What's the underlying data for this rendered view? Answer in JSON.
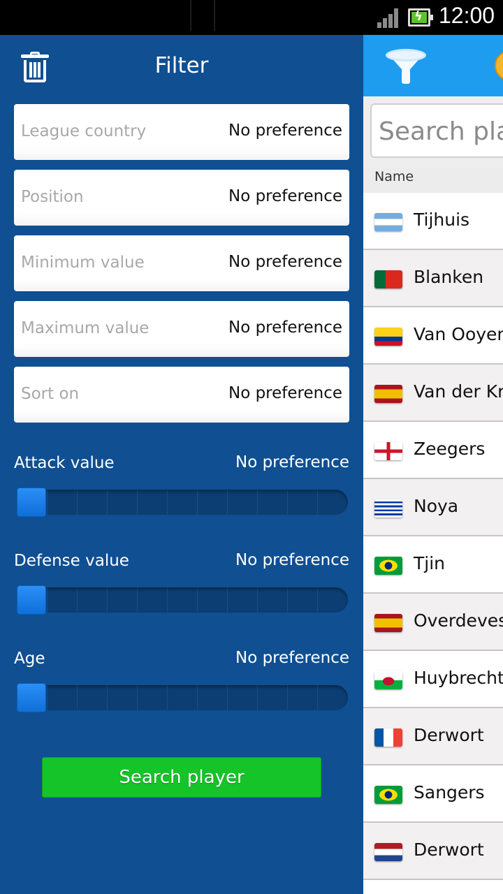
{
  "status_bar": {
    "time": "12:00"
  },
  "drawer": {
    "title": "Filter",
    "fields": [
      {
        "label": "League country",
        "value": "No preference"
      },
      {
        "label": "Position",
        "value": "No preference"
      },
      {
        "label": "Minimum value",
        "value": "No preference"
      },
      {
        "label": "Maximum value",
        "value": "No preference"
      },
      {
        "label": "Sort on",
        "value": "No preference"
      }
    ],
    "sliders": [
      {
        "label": "Attack value",
        "value": "No preference",
        "level": 0
      },
      {
        "label": "Defense value",
        "value": "No preference",
        "level": 0
      },
      {
        "label": "Age",
        "value": "No preference",
        "level": 0
      }
    ],
    "search_button_label": "Search player"
  },
  "main": {
    "search_placeholder": "Search play",
    "column_header": "Name",
    "players": [
      {
        "name": "Tijhuis",
        "flag": "argentina"
      },
      {
        "name": "Blanken",
        "flag": "portugal"
      },
      {
        "name": "Van Ooyen",
        "flag": "colombia"
      },
      {
        "name": "Van der Kro",
        "flag": "spain"
      },
      {
        "name": "Zeegers",
        "flag": "england"
      },
      {
        "name": "Noya",
        "flag": "uruguay"
      },
      {
        "name": "Tjin",
        "flag": "brazil"
      },
      {
        "name": "Overdevest",
        "flag": "spain"
      },
      {
        "name": "Huybrechts",
        "flag": "wales"
      },
      {
        "name": "Derwort",
        "flag": "france"
      },
      {
        "name": "Sangers",
        "flag": "brazil"
      },
      {
        "name": "Derwort",
        "flag": "netherlands"
      }
    ]
  },
  "colors": {
    "drawer_bg": "#0f4f92",
    "action_bar": "#1e9cf0",
    "search_button": "#14c428"
  }
}
